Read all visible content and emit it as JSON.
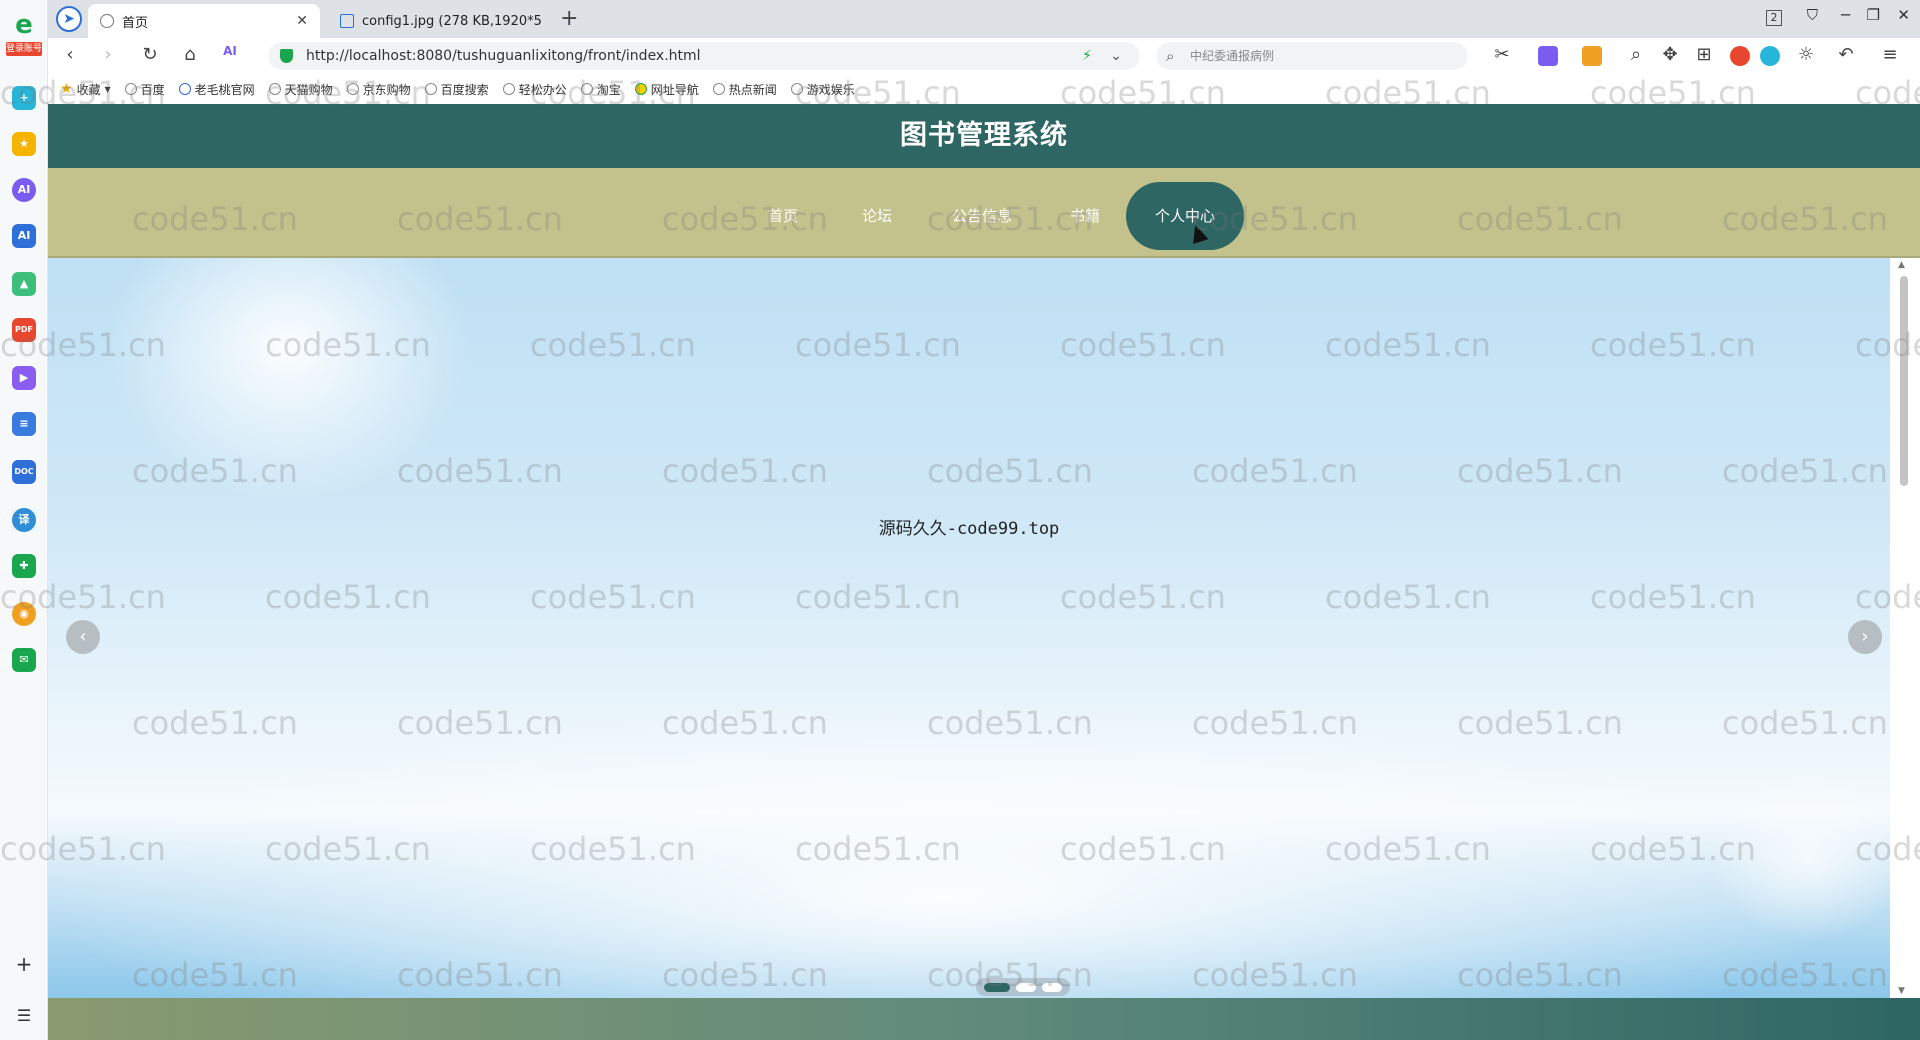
{
  "sidebar": {
    "logo_tag": "登录账号",
    "icons": [
      "plus-circle-icon",
      "star-icon",
      "ai-icon",
      "ai-box-icon",
      "image-icon",
      "pdf-icon",
      "video-icon",
      "note-icon",
      "doc-icon",
      "translate-icon",
      "game-icon",
      "weibo-icon",
      "mail-icon"
    ]
  },
  "tabs": [
    {
      "title": "首页",
      "active": true
    },
    {
      "title": "config1.jpg (278 KB,1920*5",
      "active": false
    }
  ],
  "window": {
    "page_count": "2"
  },
  "address": {
    "url": "http://localhost:8080/tushuguanlixitong/front/index.html",
    "search_placeholder": "中纪委通报病例"
  },
  "bookmarks": [
    "收藏",
    "百度",
    "老毛桃官网",
    "天猫购物",
    "京东购物",
    "百度搜索",
    "轻松办公",
    "淘宝",
    "网址导航",
    "热点新闻",
    "游戏娱乐"
  ],
  "site": {
    "title": "图书管理系统",
    "nav": [
      "首页",
      "论坛",
      "公告信息",
      "书籍",
      "个人中心"
    ],
    "active_nav": "个人中心",
    "banner_text": "源码久久-code99.top",
    "carousel": {
      "slides": 3,
      "current": 1
    }
  },
  "watermark": "code51.cn",
  "colors": {
    "header": "#2e6664",
    "nav": "#c3c28c",
    "accent": "#2e6664"
  }
}
